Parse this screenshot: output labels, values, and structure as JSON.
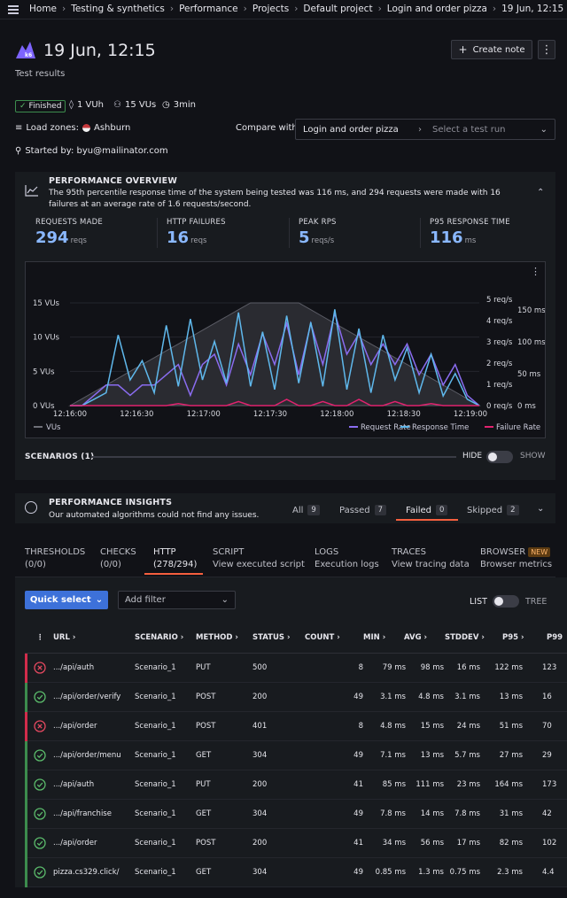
{
  "breadcrumb": [
    "Home",
    "Testing & synthetics",
    "Performance",
    "Projects",
    "Default project",
    "Login and order pizza",
    "19 Jun, 12:15"
  ],
  "header": {
    "title": "19 Jun, 12:15",
    "subtitle": "Test results",
    "create_note": "Create note",
    "status": "Finished",
    "vuh": "1 VUh",
    "vus": "15 VUs",
    "duration": "3min",
    "load_zones_label": "Load zones:",
    "load_zone": "Ashburn",
    "started_by": "Started by: byu@mailinator.com",
    "compare_label": "Compare with",
    "compare_test": "Login and order pizza",
    "compare_placeholder": "Select a test run"
  },
  "overview": {
    "title": "PERFORMANCE OVERVIEW",
    "description": "The 95th percentile response time of the system being tested was 116 ms, and 294 requests were made with 16 failures at an average rate of 1.6 requests/second.",
    "stats": [
      {
        "label": "REQUESTS MADE",
        "value": "294",
        "unit": "reqs"
      },
      {
        "label": "HTTP FAILURES",
        "value": "16",
        "unit": "reqs"
      },
      {
        "label": "PEAK RPS",
        "value": "5",
        "unit": "reqs/s"
      },
      {
        "label": "P95 RESPONSE TIME",
        "value": "116",
        "unit": "ms"
      }
    ],
    "scenarios_label": "SCENARIOS (1)",
    "hide": "HIDE",
    "show": "SHOW"
  },
  "chart_data": {
    "type": "line",
    "x": [
      "12:16:00",
      "12:16:30",
      "12:17:00",
      "12:17:30",
      "12:18:00",
      "12:18:30",
      "12:19:00"
    ],
    "y_left_ticks": [
      "15 VUs",
      "10 VUs",
      "5 VUs",
      "0 VUs"
    ],
    "y_rps_ticks": [
      "5 req/s",
      "4 req/s",
      "3 req/s",
      "2 req/s",
      "1 req/s",
      "0 req/s"
    ],
    "y_ms_ticks": [
      "150 ms",
      "100 ms",
      "50 ms",
      "0 ms"
    ],
    "series": [
      {
        "name": "VUs",
        "color": "#6e6f77",
        "values": [
          0,
          1,
          2,
          3,
          4,
          5,
          6,
          7,
          8,
          9,
          10,
          11,
          12,
          13,
          14,
          15,
          15,
          15,
          15,
          15,
          14,
          13,
          12,
          11,
          10,
          9,
          8,
          7,
          6,
          5,
          4,
          3,
          2,
          1,
          0
        ]
      },
      {
        "name": "Request Rate",
        "color": "#8a6cf0",
        "values": [
          0,
          0,
          0.5,
          1,
          1,
          0.5,
          1,
          1,
          1.5,
          2,
          0.5,
          2,
          2.5,
          1,
          3,
          1.5,
          3.5,
          2,
          4,
          1.5,
          4,
          2,
          4.5,
          2.5,
          3.5,
          2,
          3,
          2,
          3,
          1.5,
          2.5,
          1,
          2,
          0.5,
          0
        ]
      },
      {
        "name": "Response Time",
        "color": "#5fb8ec",
        "values": [
          0,
          0,
          10,
          20,
          110,
          40,
          70,
          20,
          125,
          30,
          135,
          40,
          100,
          35,
          145,
          30,
          115,
          25,
          140,
          35,
          130,
          30,
          150,
          25,
          120,
          20,
          110,
          40,
          90,
          20,
          80,
          15,
          50,
          10,
          0
        ]
      },
      {
        "name": "Failure Rate",
        "color": "#e0226e",
        "values": [
          0,
          0,
          0,
          0,
          0,
          0,
          0,
          0,
          0,
          0.1,
          0,
          0,
          0,
          0,
          0.2,
          0,
          0,
          0,
          0.3,
          0,
          0,
          0.2,
          0,
          0,
          0.3,
          0,
          0,
          0.2,
          0,
          0,
          0.1,
          0,
          0,
          0,
          0
        ]
      }
    ]
  },
  "insights": {
    "title": "PERFORMANCE INSIGHTS",
    "description": "Our automated algorithms could not find any issues.",
    "tabs": [
      {
        "label": "All",
        "count": "9"
      },
      {
        "label": "Passed",
        "count": "7"
      },
      {
        "label": "Failed",
        "count": "0"
      },
      {
        "label": "Skipped",
        "count": "2"
      }
    ]
  },
  "tabs": [
    {
      "label": "THRESHOLDS",
      "sub": "(0/0)"
    },
    {
      "label": "CHECKS",
      "sub": "(0/0)"
    },
    {
      "label": "HTTP",
      "sub": "(278/294)"
    },
    {
      "label": "SCRIPT",
      "sub": "View executed script"
    },
    {
      "label": "LOGS",
      "sub": "Execution logs"
    },
    {
      "label": "TRACES",
      "sub": "View tracing data"
    },
    {
      "label": "BROWSER",
      "sub": "Browser metrics",
      "badge": "NEW"
    }
  ],
  "table": {
    "quick_select": "Quick select",
    "add_filter": "Add filter",
    "list": "LIST",
    "tree": "TREE",
    "columns": [
      "URL",
      "SCENARIO",
      "METHOD",
      "STATUS",
      "COUNT",
      "MIN",
      "AVG",
      "STDDEV",
      "P95",
      "P99"
    ],
    "rows": [
      {
        "ok": false,
        "url": ".../api/auth",
        "scenario": "Scenario_1",
        "method": "PUT",
        "status": "500",
        "count": "8",
        "min": "79 ms",
        "avg": "98 ms",
        "stddev": "16 ms",
        "p95": "122 ms",
        "p99": "123"
      },
      {
        "ok": true,
        "url": ".../api/order/verify",
        "scenario": "Scenario_1",
        "method": "POST",
        "status": "200",
        "count": "49",
        "min": "3.1 ms",
        "avg": "4.8 ms",
        "stddev": "3.1 ms",
        "p95": "13 ms",
        "p99": "16"
      },
      {
        "ok": false,
        "url": ".../api/order",
        "scenario": "Scenario_1",
        "method": "POST",
        "status": "401",
        "count": "8",
        "min": "4.8 ms",
        "avg": "15 ms",
        "stddev": "24 ms",
        "p95": "51 ms",
        "p99": "70"
      },
      {
        "ok": true,
        "url": ".../api/order/menu",
        "scenario": "Scenario_1",
        "method": "GET",
        "status": "304",
        "count": "49",
        "min": "7.1 ms",
        "avg": "13 ms",
        "stddev": "5.7 ms",
        "p95": "27 ms",
        "p99": "29"
      },
      {
        "ok": true,
        "url": ".../api/auth",
        "scenario": "Scenario_1",
        "method": "PUT",
        "status": "200",
        "count": "41",
        "min": "85 ms",
        "avg": "111 ms",
        "stddev": "23 ms",
        "p95": "164 ms",
        "p99": "173"
      },
      {
        "ok": true,
        "url": ".../api/franchise",
        "scenario": "Scenario_1",
        "method": "GET",
        "status": "304",
        "count": "49",
        "min": "7.8 ms",
        "avg": "14 ms",
        "stddev": "7.8 ms",
        "p95": "31 ms",
        "p99": "42"
      },
      {
        "ok": true,
        "url": ".../api/order",
        "scenario": "Scenario_1",
        "method": "POST",
        "status": "200",
        "count": "41",
        "min": "34 ms",
        "avg": "56 ms",
        "stddev": "17 ms",
        "p95": "82 ms",
        "p99": "102"
      },
      {
        "ok": true,
        "url": "pizza.cs329.click/",
        "scenario": "Scenario_1",
        "method": "GET",
        "status": "304",
        "count": "49",
        "min": "0.85 ms",
        "avg": "1.3 ms",
        "stddev": "0.75 ms",
        "p95": "2.3 ms",
        "p99": "4.4"
      }
    ]
  }
}
